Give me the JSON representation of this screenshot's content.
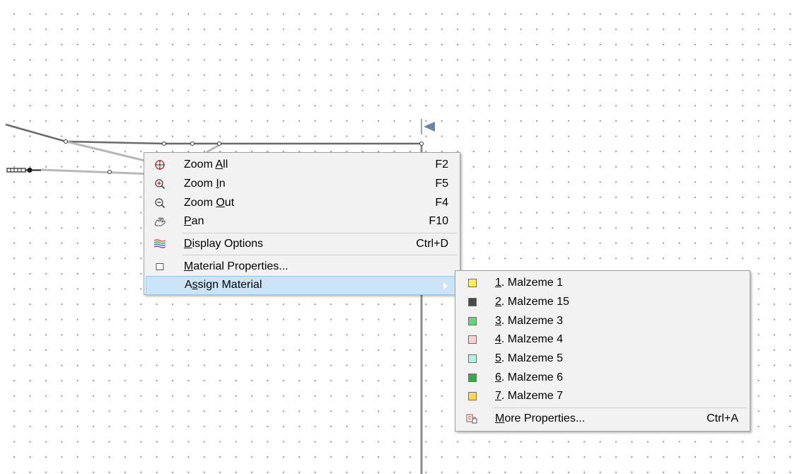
{
  "context_menu": {
    "items": [
      {
        "pre": "Zoom ",
        "acc": "A",
        "post": "ll",
        "shortcut": "F2"
      },
      {
        "pre": "Zoom ",
        "acc": "I",
        "post": "n",
        "shortcut": "F5"
      },
      {
        "pre": "Zoom ",
        "acc": "O",
        "post": "ut",
        "shortcut": "F4"
      },
      {
        "pre": "",
        "acc": "P",
        "post": "an",
        "shortcut": "F10"
      },
      {
        "pre": "",
        "acc": "D",
        "post": "isplay Options",
        "shortcut": "Ctrl+D"
      },
      {
        "pre": "",
        "acc": "M",
        "post": "aterial Properties...",
        "shortcut": ""
      },
      {
        "pre": "A",
        "acc": "s",
        "post": "sign Material",
        "shortcut": ""
      }
    ]
  },
  "submenu": {
    "items": [
      {
        "acc": "1",
        "post": ". Malzeme 1",
        "color": "#ffef5a"
      },
      {
        "acc": "2",
        "post": ". Malzeme 15",
        "color": "#4a4a4a"
      },
      {
        "acc": "3",
        "post": ". Malzeme 3",
        "color": "#6fd07a"
      },
      {
        "acc": "4",
        "post": ". Malzeme 4",
        "color": "#f8d0d4"
      },
      {
        "acc": "5",
        "post": ". Malzeme 5",
        "color": "#b6f2e4"
      },
      {
        "acc": "6",
        "post": ". Malzeme 6",
        "color": "#3da84a"
      },
      {
        "acc": "7",
        "post": ". Malzeme 7",
        "color": "#ffd65a"
      }
    ],
    "more": {
      "acc": "M",
      "post": "ore Properties...",
      "shortcut": "Ctrl+A"
    }
  }
}
